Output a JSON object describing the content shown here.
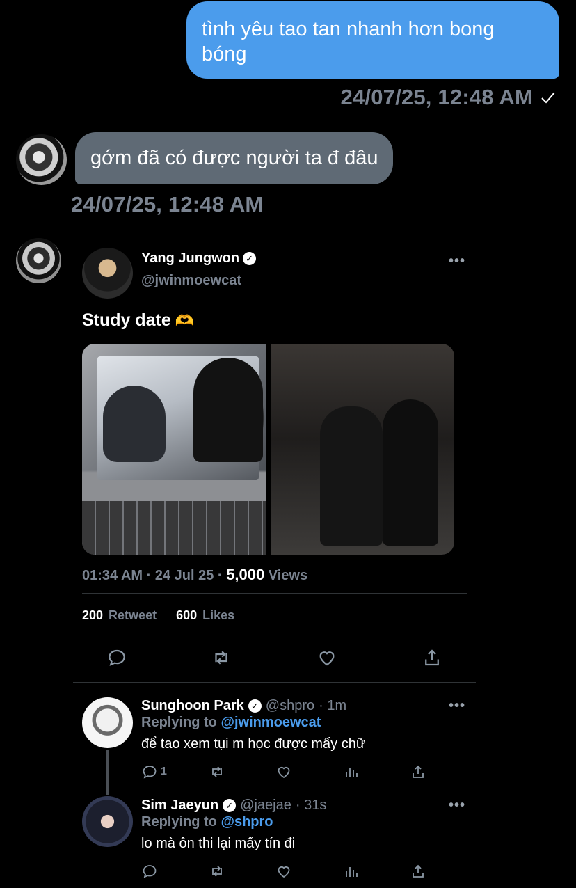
{
  "dm": {
    "outgoing": {
      "text": "tình yêu tao tan nhanh hơn bong bóng",
      "timestamp": "24/07/25, 12:48 AM"
    },
    "incoming": {
      "text": "gớm đã có được người ta đ đâu",
      "timestamp": "24/07/25, 12:48 AM"
    }
  },
  "tweet": {
    "author_name": "Yang Jungwon",
    "author_handle": "@jwinmoewcat",
    "more": "•••",
    "text": "Study date",
    "emoji": "🫶",
    "meta_time": "01:34 AM · 24 Jul 25 · ",
    "views_count": "5,000",
    "views_label": " Views",
    "retweets": "200",
    "retweets_label": "Retweet",
    "likes": "600",
    "likes_label": "Likes"
  },
  "replies": [
    {
      "name": "Sunghoon Park",
      "handle": "@shpro",
      "time": "· 1m",
      "replying_prefix": "Replying to ",
      "replying_to": "@jwinmoewcat",
      "text": "để tao xem tụi m học được mấy chữ",
      "reply_count": "1",
      "more": "•••"
    },
    {
      "name": "Sim Jaeyun",
      "handle": "@jaejae",
      "time": "· 31s",
      "replying_prefix": "Replying to ",
      "replying_to": "@shpro",
      "text": "lo mà ôn thi lại mấy tín đi",
      "reply_count": "",
      "more": "•••"
    }
  ],
  "colors": {
    "background": "#000000",
    "outgoing_bubble": "#4b9cec",
    "incoming_bubble": "#5f6a75",
    "secondary_text": "#7b8491",
    "link": "#4b9cec"
  }
}
